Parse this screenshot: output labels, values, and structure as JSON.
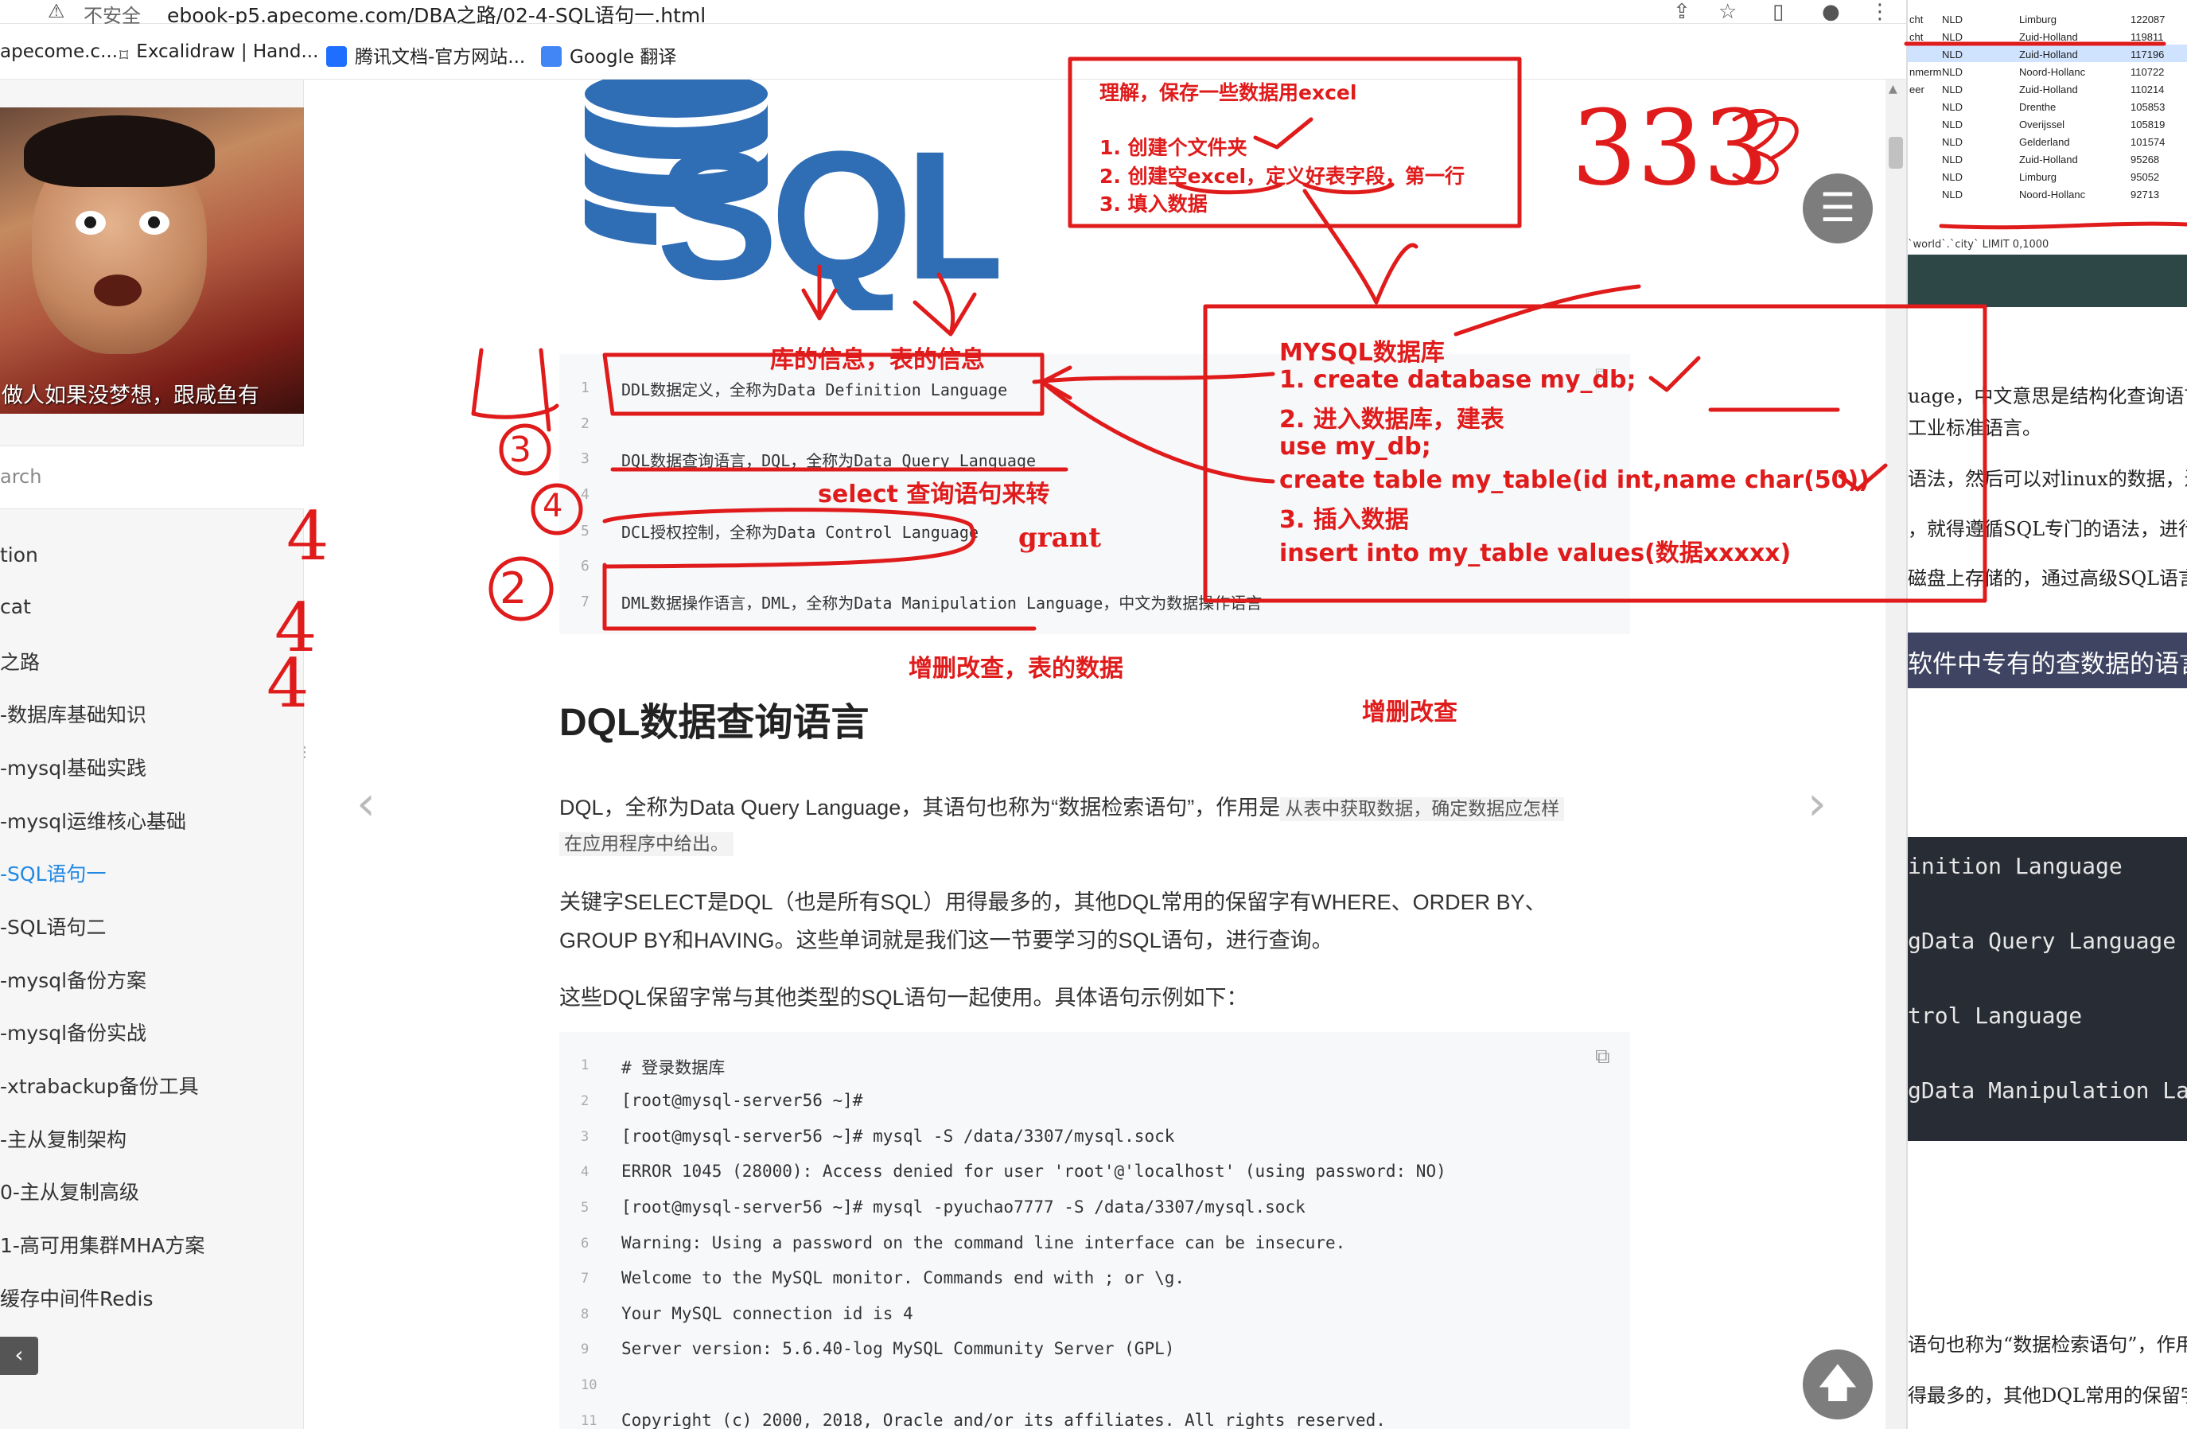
{
  "browser": {
    "warning_glyph": "⚠",
    "insecure_label": "不安全",
    "url": "ebook-p5.apecome.com/DBA之路/02-4-SQL语句一.html",
    "bookmarks": [
      "apecome.c...",
      "Excalidraw | Hand...",
      "腾讯文档-官方网站...",
      "Google 翻译"
    ]
  },
  "sidebar": {
    "avatar_caption": "做人如果没梦想，跟咸鱼有",
    "search_placeholder": "arch",
    "items": [
      {
        "label": "tion"
      },
      {
        "label": "cat"
      },
      {
        "label": "之路"
      },
      {
        "label": "-数据库基础知识"
      },
      {
        "label": "-mysql基础实践"
      },
      {
        "label": "-mysql运维核心基础"
      },
      {
        "label": "-SQL语句一",
        "active": true
      },
      {
        "label": "-SQL语句二"
      },
      {
        "label": "-mysql备份方案"
      },
      {
        "label": "-mysql备份实战"
      },
      {
        "label": "-xtrabackup备份工具"
      },
      {
        "label": "-主从复制架构"
      },
      {
        "label": "0-主从复制高级"
      },
      {
        "label": "1-高可用集群MHA方案"
      },
      {
        "label": "缓存中间件Redis"
      }
    ],
    "collapse_label": "‹"
  },
  "code_block_1": {
    "lines": [
      {
        "n": "1",
        "text": "DDL数据定义，全称为Data Definition Language"
      },
      {
        "n": "2",
        "text": ""
      },
      {
        "n": "3",
        "text": "DQL数据查询语言，DQL，全称为Data Query Language"
      },
      {
        "n": "4",
        "text": ""
      },
      {
        "n": "5",
        "text": "DCL授权控制，全称为Data Control Language"
      },
      {
        "n": "6",
        "text": ""
      },
      {
        "n": "7",
        "text": "DML数据操作语言，DML，全称为Data Manipulation Language，中文为数据操作语言"
      }
    ]
  },
  "article": {
    "heading": "DQL数据查询语言",
    "p1_text": "DQL，全称为Data Query Language，其语句也称为“数据检索语句”，作用是",
    "p1_code": "从表中获取数据，确定数据应怎样",
    "p1_code2": "在应用程序中给出。",
    "p2_line1": "关键字SELECT是DQL（也是所有SQL）用得最多的，其他DQL常用的保留字有WHERE、ORDER BY、",
    "p2_line2": "GROUP BY和HAVING。这些单词就是我们这一节要学习的SQL语句，进行查询。",
    "p3": "这些DQL保留字常与其他类型的SQL语句一起使用。具体语句示例如下："
  },
  "code_block_2": {
    "lines": [
      {
        "n": "1",
        "text": "# 登录数据库"
      },
      {
        "n": "2",
        "text": "[root@mysql-server56 ~]#"
      },
      {
        "n": "3",
        "text": "[root@mysql-server56 ~]# mysql -S /data/3307/mysql.sock"
      },
      {
        "n": "4",
        "text": "ERROR 1045 (28000): Access denied for user 'root'@'localhost' (using password: NO)"
      },
      {
        "n": "5",
        "text": "[root@mysql-server56 ~]# mysql -pyuchao7777 -S /data/3307/mysql.sock"
      },
      {
        "n": "6",
        "text": "Warning: Using a password on the command line interface can be insecure."
      },
      {
        "n": "7",
        "text": "Welcome to the MySQL monitor.  Commands end with ; or \\g."
      },
      {
        "n": "8",
        "text": "Your MySQL connection id is 4"
      },
      {
        "n": "9",
        "text": "Server version: 5.6.40-log MySQL Community Server (GPL)"
      },
      {
        "n": "10",
        "text": ""
      },
      {
        "n": "11",
        "text": "Copyright (c) 2000, 2018, Oracle and/or its affiliates. All rights reserved."
      }
    ]
  },
  "controls": {
    "menu_glyph": "☰",
    "top_glyph": "🡅",
    "prev_glyph": "‹",
    "next_glyph": "›",
    "copy_glyph": "⧉"
  },
  "right_pane": {
    "rows": [
      {
        "a": "cht",
        "b": "NLD",
        "c": "Limburg",
        "d": "122087"
      },
      {
        "a": "cht",
        "b": "NLD",
        "c": "Zuid-Holland",
        "d": "119811"
      },
      {
        "a": "",
        "b": "NLD",
        "c": "Zuid-Holland",
        "d": "117196"
      },
      {
        "a": "nmerm",
        "b": "NLD",
        "c": "Noord-Hollanc",
        "d": "110722"
      },
      {
        "a": "eer",
        "b": "NLD",
        "c": "Zuid-Holland",
        "d": "110214"
      },
      {
        "a": "",
        "b": "NLD",
        "c": "Drenthe",
        "d": "105853"
      },
      {
        "a": "",
        "b": "NLD",
        "c": "Overijssel",
        "d": "105819"
      },
      {
        "a": "",
        "b": "NLD",
        "c": "Gelderland",
        "d": "101574"
      },
      {
        "a": "",
        "b": "NLD",
        "c": "Zuid-Holland",
        "d": "95268"
      },
      {
        "a": "",
        "b": "NLD",
        "c": "Limburg",
        "d": "95052"
      },
      {
        "a": "",
        "b": "NLD",
        "c": "Noord-Hollanc",
        "d": "92713"
      }
    ],
    "query_text": "`world`.`city` LIMIT 0,1000",
    "text1": "uage，中文意思是结构化查询语言",
    "text2": "工业标准语言。",
    "text3": "语法，然后可以对linux的数据，进",
    "text4": "，就得遵循SQL专门的语法，进行",
    "text5": "磁盘上存储的，通过高级SQL语言",
    "heading": "软件中专有的查数据的语言",
    "code_lines": [
      "inition Language",
      "gData Query Language",
      "trol Language",
      "gData Manipulation Lan"
    ],
    "text6": "语句也称为“数据检索语句”，作用是",
    "text7": "得最多的，其他DQL常用的保留字"
  },
  "annotations": {
    "box_top": [
      "理解，保存一些数据用excel",
      "1. 创建个文件夹",
      "2.  创建空excel，定义好表字段，第一行",
      "3.  填入数据"
    ],
    "big_box": [
      "MYSQL数据库",
      "1.  create database     my_db;",
      "2. 进入数据库，建表",
      "use my_db;",
      "create table  my_table(id int,name char(50))",
      "3. 插入数据",
      "insert into my_table values(数据xxxxx)"
    ],
    "label_lib": "库的信息，表的信息",
    "label_select": "select 查询语句来转",
    "label_grant": "grant",
    "label_crud1": "增删改查，表的数据",
    "label_crud2": "增删改查",
    "number_333": "333",
    "number_4": "4",
    "number_3": "3",
    "number_4b": "4",
    "number_2": "2",
    "big_4s": [
      "4",
      "4",
      "4"
    ]
  },
  "theme": {
    "annotation_red": "#e01b1b",
    "link_blue": "#1e88e5",
    "sql_blue": "#2f6db5"
  }
}
